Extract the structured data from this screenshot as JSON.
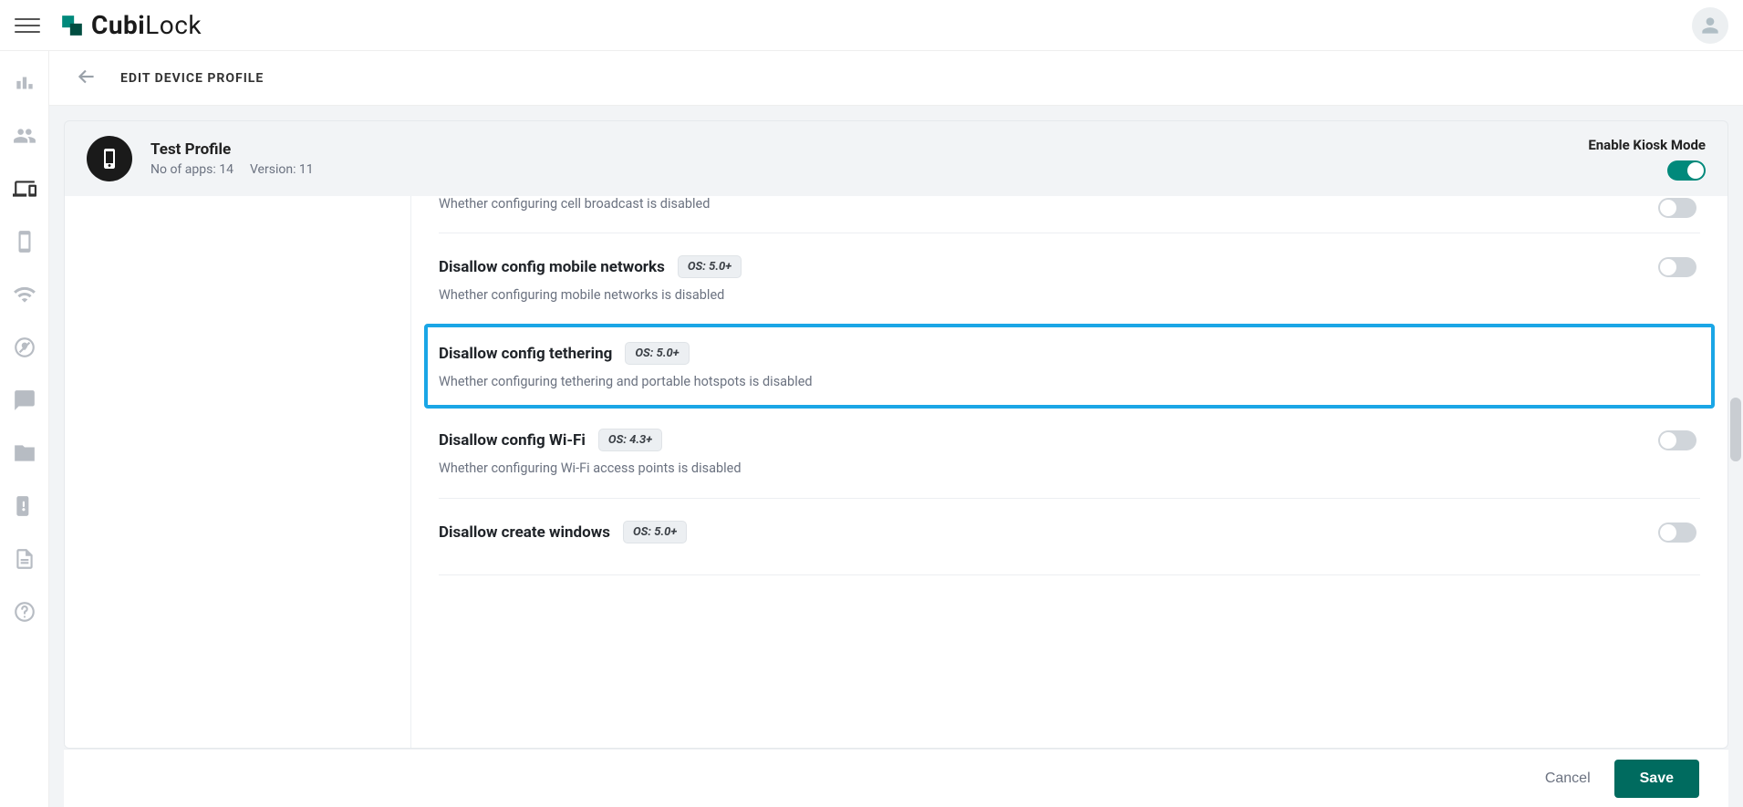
{
  "brand": {
    "name_prefix": "Cubi",
    "name_suffix": "Lock"
  },
  "page": {
    "title": "EDIT DEVICE PROFILE"
  },
  "profile": {
    "name": "Test Profile",
    "apps_label": "No of apps: 14",
    "version_label": "Version: 11",
    "kiosk_label": "Enable Kiosk Mode",
    "kiosk_on": true
  },
  "settings": [
    {
      "key": "cell_broadcast",
      "title": "",
      "os": "",
      "desc": "Whether configuring cell broadcast is disabled",
      "on": false,
      "cut_top": true
    },
    {
      "key": "mobile_networks",
      "title": "Disallow config mobile networks",
      "os": "OS: 5.0+",
      "desc": "Whether configuring mobile networks is disabled",
      "on": false
    },
    {
      "key": "tethering",
      "title": "Disallow config tethering",
      "os": "OS: 5.0+",
      "desc": "Whether configuring tethering and portable hotspots is disabled",
      "on": false,
      "highlight": true
    },
    {
      "key": "wifi",
      "title": "Disallow config Wi-Fi",
      "os": "OS: 4.3+",
      "desc": "Whether configuring Wi-Fi access points is disabled",
      "on": false
    },
    {
      "key": "create_windows",
      "title": "Disallow create windows",
      "os": "OS: 5.0+",
      "desc": "",
      "on": false
    }
  ],
  "footer": {
    "cancel": "Cancel",
    "save": "Save"
  },
  "sidenav": [
    {
      "name": "analytics",
      "icon": "bars"
    },
    {
      "name": "users",
      "icon": "users"
    },
    {
      "name": "devices",
      "icon": "devices",
      "active": true
    },
    {
      "name": "apps",
      "icon": "phone-app"
    },
    {
      "name": "wifi",
      "icon": "wifi"
    },
    {
      "name": "geofence",
      "icon": "map-pin-off"
    },
    {
      "name": "messages",
      "icon": "chat"
    },
    {
      "name": "files",
      "icon": "folder"
    },
    {
      "name": "keys",
      "icon": "key"
    },
    {
      "name": "logs",
      "icon": "doc"
    },
    {
      "name": "help",
      "icon": "help"
    }
  ]
}
